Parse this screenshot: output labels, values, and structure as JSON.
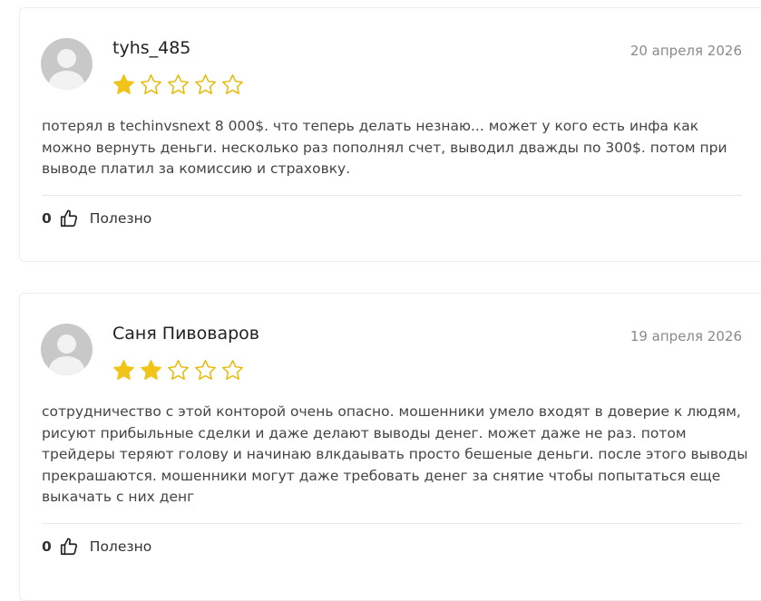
{
  "reviews": [
    {
      "author": "tyhs_485",
      "date": "20 апреля 2026",
      "rating": 1,
      "max_rating": 5,
      "text": "потерял в techinvsnext 8 000$. что теперь делать незнаю... может у кого есть инфа как можно вернуть деньги. несколько раз пополнял счет, выводил дважды по 300$. потом при выводе платил за комиссию и страховку.",
      "likes": "0",
      "useful_label": "Полезно"
    },
    {
      "author": "Саня Пивоваров",
      "date": "19 апреля 2026",
      "rating": 2,
      "max_rating": 5,
      "text": "сотрудничество с этой конторой очень опасно. мошенники умело входят в доверие к людям, рисуют прибыльные сделки и даже делают выводы денег. может даже не раз. потом трейдеры теряют голову и начинаю влкдаывать просто бешеные деньги. после этого выводы прекрашаются. мошенники могут даже требовать денег за снятие чтобы попытаться еще выкачать с них денг",
      "likes": "0",
      "useful_label": "Полезно"
    }
  ],
  "colors": {
    "star_filled": "#f0c419",
    "star_outline": "#e6b800",
    "avatar_bg": "#c8c8c8"
  },
  "icons": {
    "avatar": "user-silhouette",
    "like": "thumbs-up-outline",
    "star": "star"
  }
}
